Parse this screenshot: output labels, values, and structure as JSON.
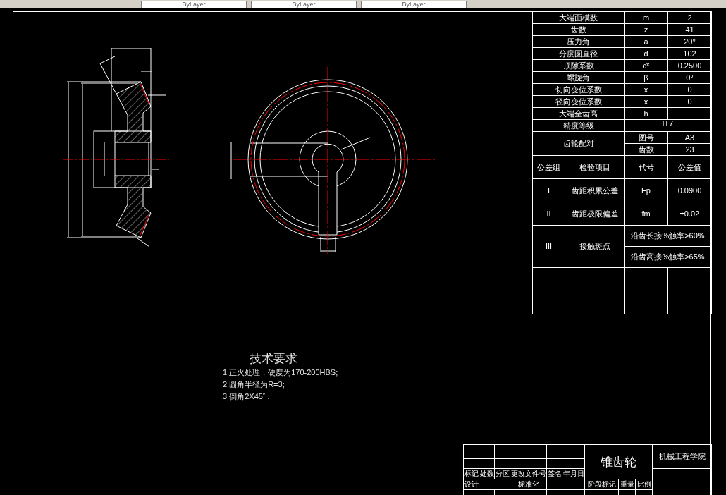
{
  "toolbar": {
    "dropdowns": [
      {
        "value": "ByLayer"
      },
      {
        "value": "ByLayer"
      },
      {
        "value": "ByLayer"
      }
    ]
  },
  "gear_parameters": [
    {
      "kind": "row",
      "name": "大端面模数",
      "symbol": "m",
      "value": "2"
    },
    {
      "kind": "row",
      "name": "齿数",
      "symbol": "z",
      "value": "41"
    },
    {
      "kind": "row",
      "name": "压力角",
      "symbol": "a",
      "value": "20°"
    },
    {
      "kind": "row",
      "name": "分度圆直径",
      "symbol": "d",
      "value": "102"
    },
    {
      "kind": "row",
      "name": "顶隙系数",
      "symbol": "c*",
      "value": "0.2500"
    },
    {
      "kind": "row",
      "name": "螺旋角",
      "symbol": "β",
      "value": "0°"
    },
    {
      "kind": "row",
      "name": "切向变位系数",
      "symbol": "x",
      "value": "0"
    },
    {
      "kind": "row",
      "name": "径向变位系数",
      "symbol": "x",
      "value": "0"
    },
    {
      "kind": "row",
      "name": "大端全齿高",
      "symbol": "h"
    },
    {
      "kind": "span",
      "name": "精度等级",
      "value": "IT7"
    }
  ],
  "gear_pairing": {
    "label": "齿轮配对",
    "items": [
      {
        "name": "图号",
        "value": "A3"
      },
      {
        "name": "齿数",
        "value": "23"
      }
    ]
  },
  "tolerance_table": {
    "columns": [
      "公差组",
      "检验项目",
      "代号",
      "公差值"
    ],
    "rows": [
      {
        "kind": "single",
        "group": "I",
        "item": "齿距积累公差",
        "code": "Fp",
        "value": "0.0900"
      },
      {
        "kind": "single",
        "group": "II",
        "item": "齿距极限偏差",
        "code": "fm",
        "value": "±0.02"
      },
      {
        "kind": "notes",
        "group": "III",
        "item": "接触斑点",
        "notes": [
          "沿齿长接%触率>60%",
          "沿齿高接%触率>65%"
        ]
      }
    ]
  },
  "technical_requirements": {
    "title": "技术要求",
    "items": [
      "1.正火处理，硬度为170-200HBS;",
      "2.圆角半径为R=3;",
      "3.倒角2X45˚ ."
    ]
  },
  "title_block": {
    "part_name": "锥齿轮",
    "school": "机械工程学院",
    "change_labels": [
      "标记",
      "处数",
      "分区",
      "更改文件号",
      "签名",
      "年月日"
    ],
    "design_label": "设计",
    "standard_label": "标准化",
    "stage_label": "阶段标记",
    "weight_label": "重量",
    "scale_label": "比例"
  }
}
